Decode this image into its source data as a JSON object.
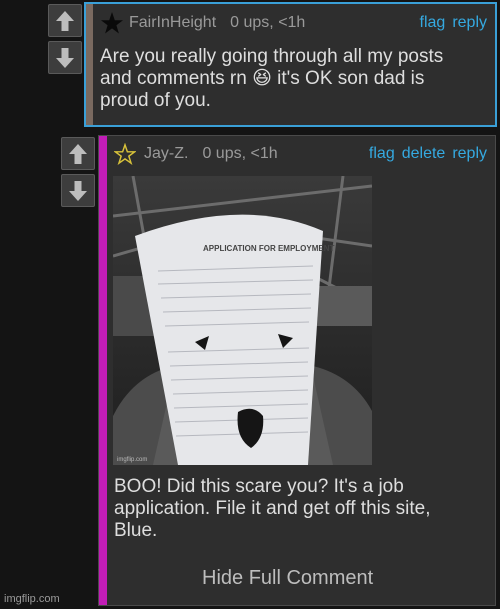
{
  "comment1": {
    "username": "FairInHeight",
    "meta": "0 ups, <1h",
    "actions": [
      "flag",
      "reply"
    ],
    "lines": [
      "Are you really going through all my posts",
      "and comments rn 😆 it's OK son dad is",
      "proud of you."
    ],
    "accent_color": "#7a6a60",
    "border_color": "#3aa0d8",
    "avatar_icon": "star-filled-icon"
  },
  "comment2": {
    "username": "Jay-Z.",
    "meta": "0 ups, <1h",
    "actions": [
      "flag",
      "delete",
      "reply"
    ],
    "image_watermark": "imgflip.com",
    "image_caption": "APPLICATION FOR EMPLOYMENT",
    "lines": [
      "BOO! Did this scare you? It's a job",
      "application. File it and get off this site,",
      "Blue."
    ],
    "hide_label": "Hide Full Comment",
    "accent_color": "#c21db7",
    "avatar_icon": "star-outline-icon"
  },
  "watermark": "imgflip.com",
  "colors": {
    "background": "#141414",
    "link": "#35a9e0",
    "panel": "#2e2e2e"
  }
}
